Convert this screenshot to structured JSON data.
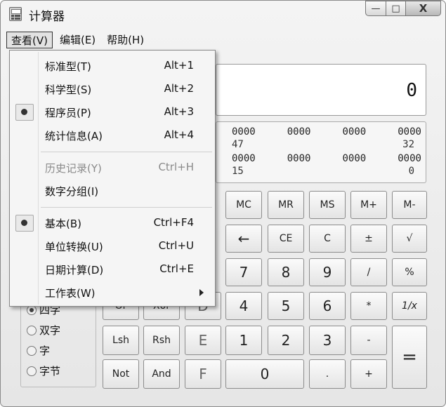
{
  "window": {
    "title": "计算器"
  },
  "controls": {
    "minimize": "—",
    "maximize": "□",
    "close": "X"
  },
  "menubar": {
    "items": [
      "查看(V)",
      "编辑(E)",
      "帮助(H)"
    ]
  },
  "display": {
    "value": "0"
  },
  "bits": {
    "row1": [
      "0000",
      "0000",
      "0000",
      "0000"
    ],
    "pos1": [
      "47",
      "32"
    ],
    "row2": [
      "0000",
      "0000",
      "0000",
      "0000"
    ],
    "pos2": [
      "15",
      "0"
    ]
  },
  "view_menu": {
    "items": [
      {
        "label": "标准型(T)",
        "accel": "Alt+1"
      },
      {
        "label": "科学型(S)",
        "accel": "Alt+2"
      },
      {
        "label": "程序员(P)",
        "accel": "Alt+3"
      },
      {
        "label": "统计信息(A)",
        "accel": "Alt+4"
      },
      {
        "label": "历史记录(Y)",
        "accel": "Ctrl+H"
      },
      {
        "label": "数字分组(I)",
        "accel": ""
      },
      {
        "label": "基本(B)",
        "accel": "Ctrl+F4"
      },
      {
        "label": "单位转换(U)",
        "accel": "Ctrl+U"
      },
      {
        "label": "日期计算(D)",
        "accel": "Ctrl+E"
      },
      {
        "label": "工作表(W)",
        "accel": ""
      }
    ]
  },
  "keys": {
    "mc": "MC",
    "mr": "MR",
    "ms": "MS",
    "mplus": "M+",
    "mminus": "M-",
    "back": "←",
    "ce": "CE",
    "c": "C",
    "pm": "±",
    "sqrt": "√",
    "k7": "7",
    "k8": "8",
    "k9": "9",
    "div": "/",
    "pct": "%",
    "or": "Or",
    "xor": "Xor",
    "d": "D",
    "k4": "4",
    "k5": "5",
    "k6": "6",
    "mul": "*",
    "inv": "1/x",
    "lsh": "Lsh",
    "rsh": "Rsh",
    "e": "E",
    "k1": "1",
    "k2": "2",
    "k3": "3",
    "sub": "-",
    "eq": "=",
    "not": "Not",
    "and": "And",
    "f": "F",
    "k0": "0",
    "dot": ".",
    "add": "+"
  },
  "word_size": {
    "options": [
      "四字",
      "双字",
      "字",
      "字节"
    ],
    "selected": "四字"
  }
}
